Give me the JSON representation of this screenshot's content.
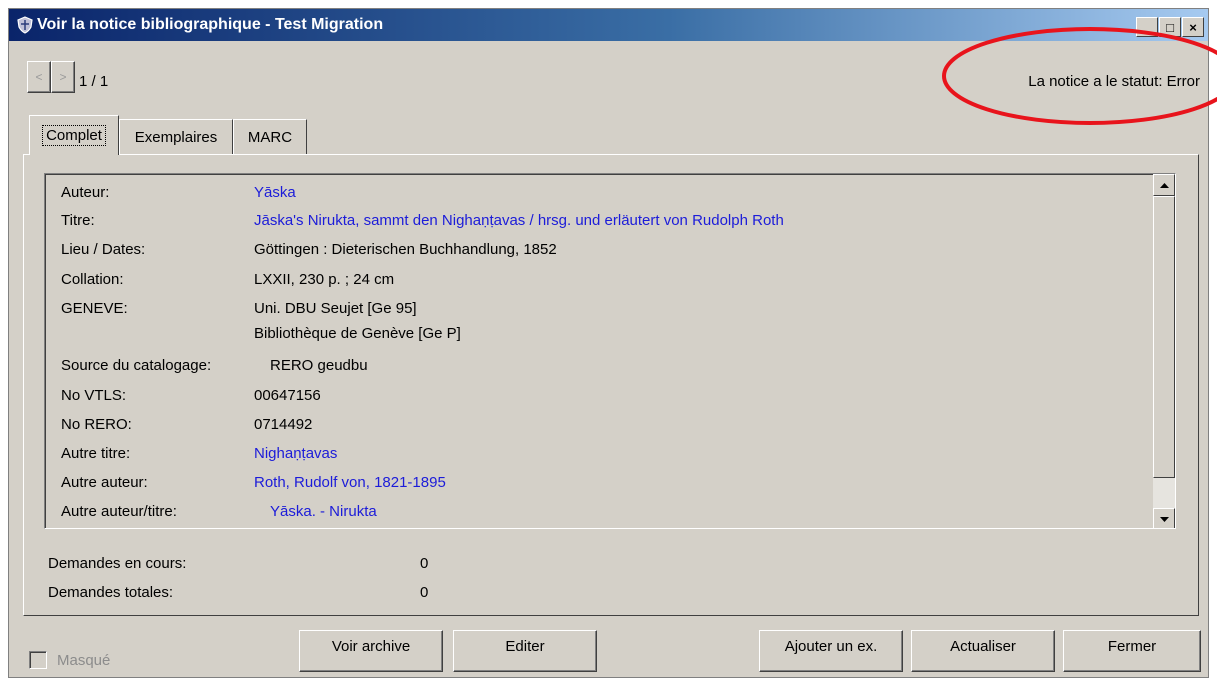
{
  "window": {
    "title": "Voir la notice bibliographique - Test Migration",
    "controls": {
      "minimize": "_",
      "maximize": "□",
      "close": "×"
    }
  },
  "navigation": {
    "prev_label": "<",
    "next_label": ">",
    "counter": "1 / 1"
  },
  "status": {
    "text": "La notice a le statut: Error",
    "highlight_color": "#e8141c"
  },
  "tabs": [
    {
      "label": "Complet",
      "active": true
    },
    {
      "label": "Exemplaires",
      "active": false
    },
    {
      "label": "MARC",
      "active": false
    }
  ],
  "record": {
    "fields": [
      {
        "label": "Auteur:",
        "value": "Yāska",
        "link": true
      },
      {
        "label": "Titre:",
        "value": "Jāska's Nirukta, sammt den Nighaṇṭavas / hrsg. und erläutert von Rudolph Roth",
        "link": true
      },
      {
        "label": "Lieu / Dates:",
        "value": "Göttingen : Dieterischen Buchhandlung, 1852",
        "link": false
      },
      {
        "label": "Collation:",
        "value": "LXXII, 230 p. ; 24 cm",
        "link": false
      },
      {
        "label": "GENEVE:",
        "value": "Uni. DBU Seujet  [Ge 95]",
        "value2": "Bibliothèque de Genève  [Ge P]",
        "link": false
      },
      {
        "label": "Source du catalogage:",
        "value": "RERO geudbu",
        "link": false
      },
      {
        "label": "No VTLS:",
        "value": "00647156",
        "link": false
      },
      {
        "label": "No RERO:",
        "value": "0714492",
        "link": false
      },
      {
        "label": "Autre titre:",
        "value": "Nighaṇṭavas",
        "link": true
      },
      {
        "label": "Autre auteur:",
        "value": "Roth, Rudolf von, 1821-1895",
        "link": true
      },
      {
        "label": "Autre auteur/titre:",
        "value": "Yāska. - Nirukta",
        "link": true
      }
    ],
    "link_color": "#1c1cd9"
  },
  "summary": {
    "current_requests_label": "Demandes en cours:",
    "current_requests_value": "0",
    "total_requests_label": "Demandes totales:",
    "total_requests_value": "0"
  },
  "footer": {
    "masked_checkbox_label": "Masqué",
    "masked_checked": false,
    "buttons": {
      "view_archive": "Voir archive",
      "edit": "Editer",
      "add_item": "Ajouter un ex.",
      "refresh": "Actualiser",
      "close": "Fermer"
    }
  }
}
